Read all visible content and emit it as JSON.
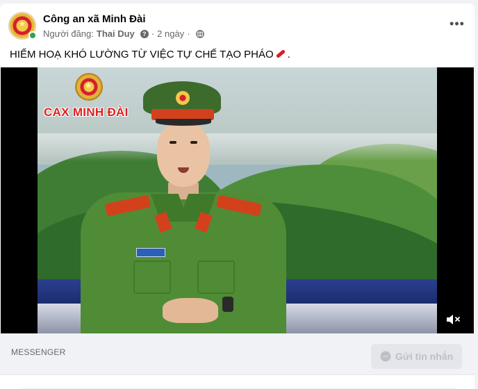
{
  "post": {
    "page_name": "Công an xã Minh Đài",
    "poster_prefix": "Người đăng:",
    "poster_name": "Thai Duy",
    "separator": "·",
    "time_ago": "2 ngày",
    "text_before": "HIỂM HOẠ KHÓ LƯỜNG TỪ VIỆC TỰ CHẾ TẠO PHÁO",
    "text_after": "."
  },
  "video": {
    "channel_name": "CAX MINH ĐÀI",
    "muted": true
  },
  "messenger": {
    "label": "MESSENGER",
    "send_label": "Gửi tin nhắn"
  },
  "icons": {
    "more": "more-options-icon",
    "globe": "globe-icon",
    "info": "question-icon",
    "mute": "speaker-muted-icon",
    "messenger": "messenger-icon"
  },
  "colors": {
    "online": "#31a24c",
    "channel_red": "#e02020",
    "button_disabled_bg": "#e4e6eb",
    "button_disabled_text": "#bcc0c4"
  }
}
